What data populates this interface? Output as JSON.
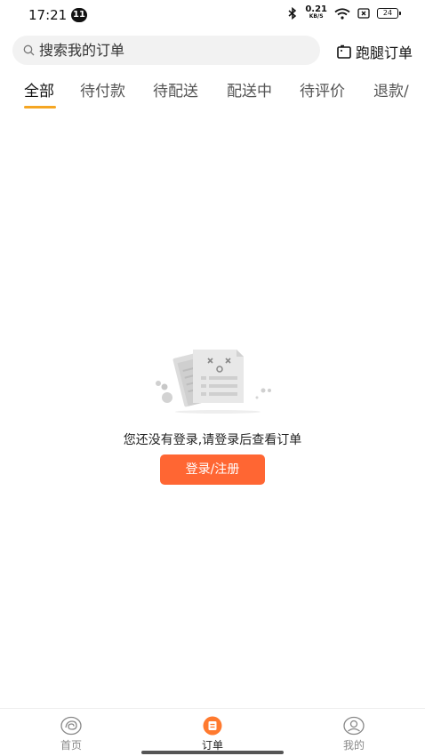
{
  "status_bar": {
    "time": "17:21",
    "notification_count": "11",
    "net_speed_value": "0.21",
    "net_speed_unit": "KB/S",
    "battery": "24"
  },
  "search": {
    "placeholder": "搜索我的订单",
    "value": ""
  },
  "errand_button": {
    "label": "跑腿订单"
  },
  "tabs": [
    {
      "label": "全部",
      "active": true
    },
    {
      "label": "待付款",
      "active": false
    },
    {
      "label": "待配送",
      "active": false
    },
    {
      "label": "配送中",
      "active": false
    },
    {
      "label": "待评价",
      "active": false
    },
    {
      "label": "退款/",
      "active": false
    }
  ],
  "empty_state": {
    "message": "您还没有登录,请登录后查看订单",
    "button_label": "登录/注册"
  },
  "bottom_nav": [
    {
      "label": "首页",
      "icon": "home-icon",
      "active": false
    },
    {
      "label": "订单",
      "icon": "order-icon",
      "active": true
    },
    {
      "label": "我的",
      "icon": "profile-icon",
      "active": false
    }
  ],
  "colors": {
    "accent": "#ff6633",
    "tab_indicator": "#f5a623",
    "nav_active": "#ff7a2f"
  }
}
